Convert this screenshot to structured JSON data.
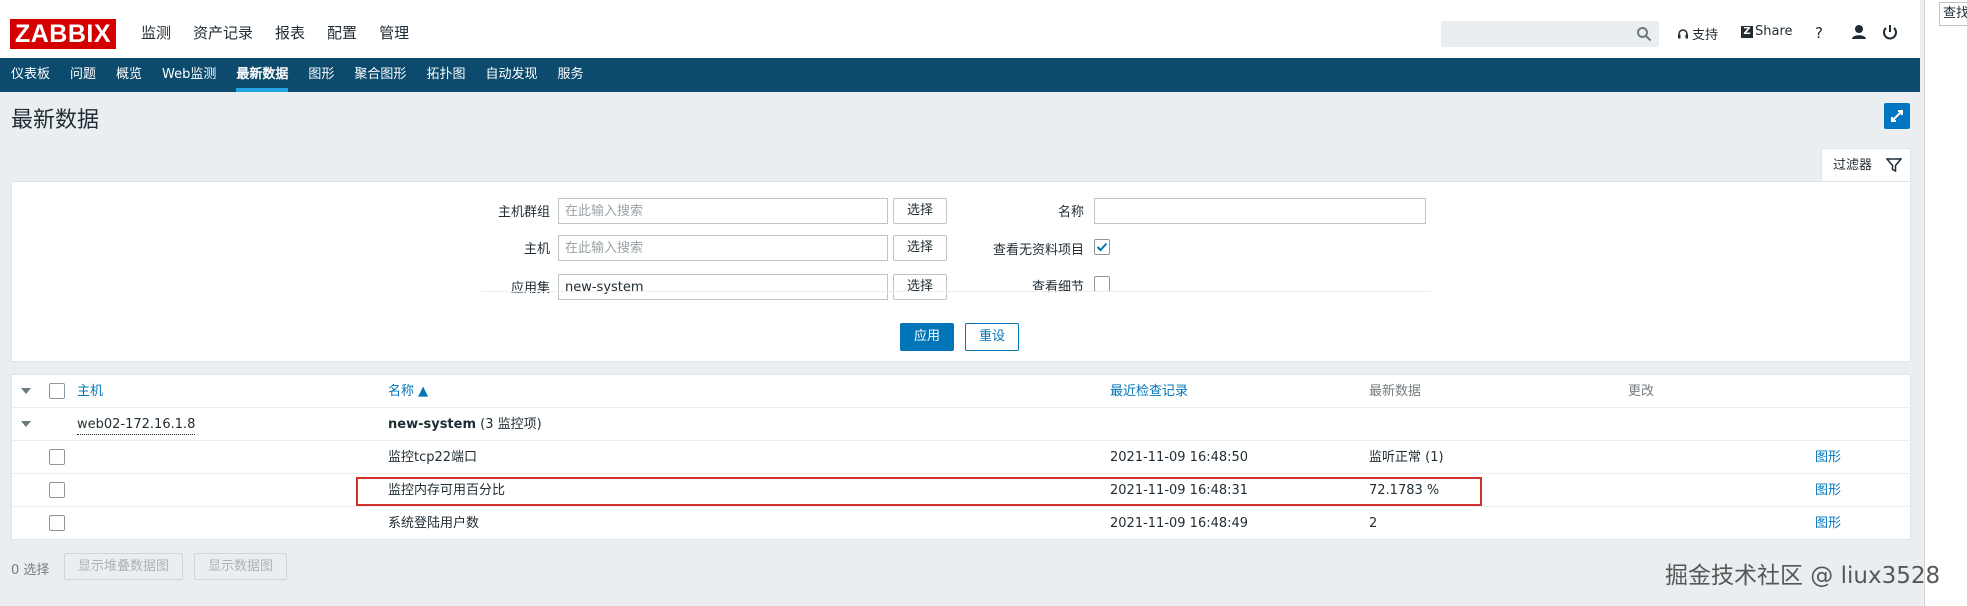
{
  "app": {
    "logo": "ZABBIX"
  },
  "mainnav": [
    "监测",
    "资产记录",
    "报表",
    "配置",
    "管理"
  ],
  "header": {
    "support": "支持",
    "share": "Share",
    "help": "?"
  },
  "side_stub": "查找",
  "subnav": [
    "仪表板",
    "问题",
    "概览",
    "Web监测",
    "最新数据",
    "图形",
    "聚合图形",
    "拓扑图",
    "自动发现",
    "服务"
  ],
  "page": {
    "title": "最新数据"
  },
  "filter": {
    "tab_label": "过滤器",
    "host_groups_label": "主机群组",
    "host_groups_placeholder": "在此输入搜索",
    "hosts_label": "主机",
    "hosts_placeholder": "在此输入搜索",
    "application_label": "应用集",
    "application_value": "new-system",
    "select_label": "选择",
    "name_label": "名称",
    "name_value": "",
    "show_without_data_label": "查看无资料项目",
    "show_without_data": true,
    "show_details_label": "查看细节",
    "show_details": false,
    "apply": "应用",
    "reset": "重设"
  },
  "table": {
    "headers": {
      "host": "主机",
      "name": "名称 ▲",
      "last_check": "最近检查记录",
      "last_value": "最新数据",
      "change": "更改"
    },
    "group_host": "web02-172.16.1.8",
    "group_app": "new-system",
    "group_count": "(3 监控项)",
    "rows": [
      {
        "name": "监控tcp22端口",
        "last_check": "2021-11-09 16:48:50",
        "last_value": "监听正常 (1)",
        "link": "图形"
      },
      {
        "name": "监控内存可用百分比",
        "last_check": "2021-11-09 16:48:31",
        "last_value": "72.1783 %",
        "link": "图形"
      },
      {
        "name": "系统登陆用户数",
        "last_check": "2021-11-09 16:48:49",
        "last_value": "2",
        "link": "图形"
      }
    ]
  },
  "footer": {
    "selected": "0 选择",
    "stacked_graph_btn": "显示堆叠数据图",
    "graph_btn": "显示数据图"
  },
  "watermark": "掘金技术社区 @ liux3528",
  "colors": {
    "brand": "#d40000",
    "subnav": "#0c4a6e",
    "accent": "#0275b8",
    "highlight": "#d0312d"
  }
}
